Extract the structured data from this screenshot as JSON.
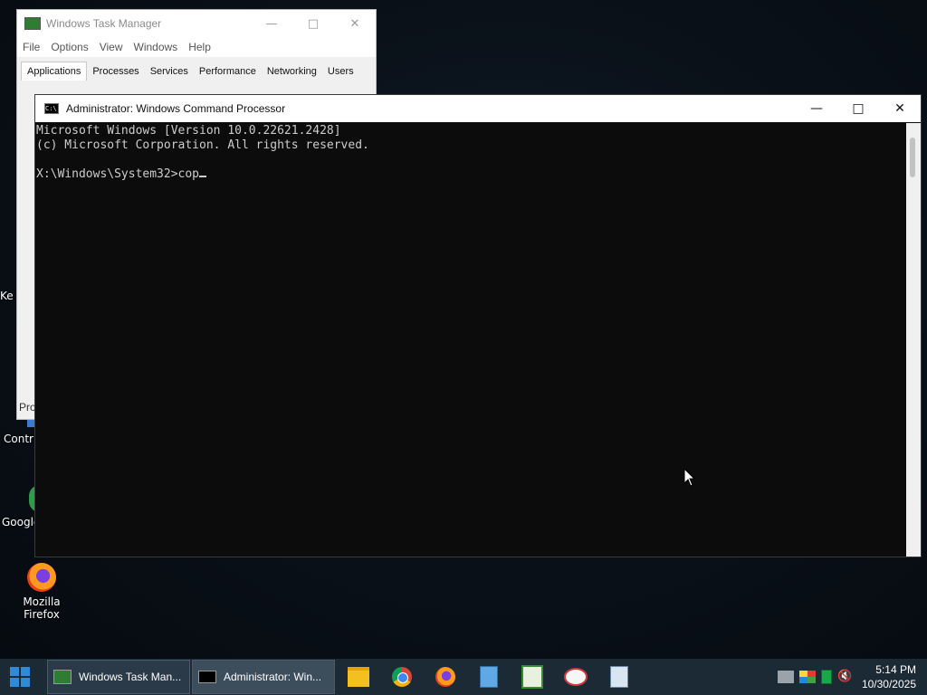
{
  "desktop": {
    "icons": [
      {
        "label": "Ke"
      },
      {
        "label": "Contr"
      },
      {
        "label": "Google"
      },
      {
        "label": "Mozilla Firefox"
      }
    ]
  },
  "task_manager": {
    "title": "Windows Task Manager",
    "menu": [
      "File",
      "Options",
      "View",
      "Windows",
      "Help"
    ],
    "tabs": [
      "Applications",
      "Processes",
      "Services",
      "Performance",
      "Networking",
      "Users"
    ],
    "active_tab": "Applications",
    "footer_text": "Pro"
  },
  "cmd": {
    "title": "Administrator: Windows Command Processor",
    "lines": [
      "Microsoft Windows [Version 10.0.22621.2428]",
      "(c) Microsoft Corporation. All rights reserved.",
      "",
      "X:\\Windows\\System32>cop"
    ]
  },
  "taskbar": {
    "buttons": [
      {
        "label": "Windows Task Man..."
      },
      {
        "label": "Administrator: Win..."
      }
    ],
    "pinned": [
      "file-explorer-icon",
      "chrome-icon",
      "firefox-icon",
      "notepad-icon",
      "spreadsheet-icon",
      "paint-icon",
      "calculator-icon"
    ],
    "clock": {
      "time": "5:14 PM",
      "date": "10/30/2025"
    }
  }
}
